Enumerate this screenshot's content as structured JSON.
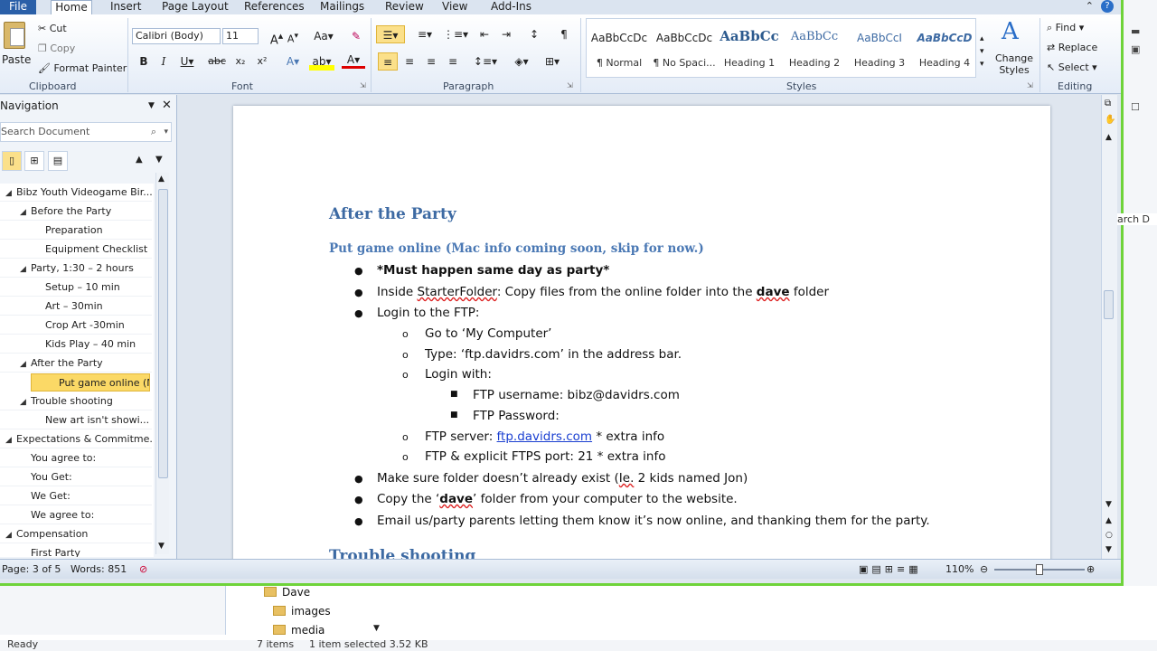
{
  "ribbon": {
    "tabs": [
      "File",
      "Home",
      "Insert",
      "Page Layout",
      "References",
      "Mailings",
      "Review",
      "View",
      "Add-Ins"
    ],
    "clipboard": {
      "paste": "Paste",
      "cut": "Cut",
      "copy": "Copy",
      "format_painter": "Format Painter",
      "label": "Clipboard"
    },
    "font": {
      "family": "Calibri (Body)",
      "size": "11",
      "label": "Font"
    },
    "paragraph": {
      "label": "Paragraph"
    },
    "styles": {
      "label": "Styles",
      "items": [
        {
          "sample": "AaBbCcDc",
          "name": "¶ Normal"
        },
        {
          "sample": "AaBbCcDc",
          "name": "¶ No Spaci..."
        },
        {
          "sample": "AaBbCc",
          "name": "Heading 1"
        },
        {
          "sample": "AaBbCc",
          "name": "Heading 2"
        },
        {
          "sample": "AaBbCcI",
          "name": "Heading 3"
        },
        {
          "sample": "AaBbCcD",
          "name": "Heading 4"
        }
      ],
      "change_styles": "Change Styles"
    },
    "editing": {
      "find": "Find",
      "replace": "Replace",
      "select": "Select",
      "label": "Editing"
    }
  },
  "nav": {
    "title": "Navigation",
    "search_placeholder": "Search Document",
    "items": [
      {
        "label": "Bibz Youth Videogame Bir...",
        "level": 0,
        "expand": true
      },
      {
        "label": "Before the Party",
        "level": 1,
        "expand": true
      },
      {
        "label": "Preparation",
        "level": 2,
        "expand": false
      },
      {
        "label": "Equipment Checklist",
        "level": 2,
        "expand": false
      },
      {
        "label": "Party, 1:30 – 2 hours",
        "level": 1,
        "expand": true
      },
      {
        "label": "Setup – 10 min",
        "level": 2,
        "expand": false
      },
      {
        "label": "Art – 30min",
        "level": 2,
        "expand": false
      },
      {
        "label": "Crop Art -30min",
        "level": 2,
        "expand": false
      },
      {
        "label": "Kids Play – 40 min",
        "level": 2,
        "expand": false
      },
      {
        "label": "After the Party",
        "level": 1,
        "expand": true
      },
      {
        "label": "Put game online (M...",
        "level": 2,
        "expand": false,
        "selected": true
      },
      {
        "label": "Trouble shooting",
        "level": 1,
        "expand": true
      },
      {
        "label": "New art isn't showi...",
        "level": 2,
        "expand": false
      },
      {
        "label": "Expectations & Commitme...",
        "level": 0,
        "expand": true
      },
      {
        "label": "You agree to:",
        "level": 1,
        "expand": false
      },
      {
        "label": "You Get:",
        "level": 1,
        "expand": false
      },
      {
        "label": "We Get:",
        "level": 1,
        "expand": false
      },
      {
        "label": "We agree to:",
        "level": 1,
        "expand": false
      },
      {
        "label": "Compensation",
        "level": 0,
        "expand": true
      },
      {
        "label": "First Party",
        "level": 1,
        "expand": false
      }
    ]
  },
  "doc": {
    "heading1": "After the Party",
    "heading2": "Put game online (Mac info coming soon, skip for now.)",
    "must": "*Must happen same day as party*",
    "inside_pre": "Inside ",
    "inside_folder": "StarterFolder",
    "inside_mid": ": Copy files from the online folder into the ",
    "inside_dave": "dave",
    "inside_post": " folder",
    "login_ftp": "Login to the FTP:",
    "goto": "Go to ‘My Computer’",
    "type": "Type: ‘ftp.davidrs.com’  in the address bar.",
    "login_with": "Login with:",
    "ftp_user": "FTP username: bibz@davidrs.com",
    "ftp_pass": "FTP Password:",
    "ftp_server_pre": "FTP server: ",
    "ftp_server_link": "ftp.davidrs.com",
    "ftp_server_post": "  * extra info",
    "ftp_port": "FTP & explicit FTPS port: 21 * extra info",
    "make_sure_pre": "Make sure folder doesn’t already exist (",
    "make_sure_ie": "Ie.",
    "make_sure_post": " 2 kids named Jon)",
    "copy_pre": "Copy the ‘",
    "copy_dave": "dave",
    "copy_post": "’ folder from your computer to the website.",
    "email": "Email us/party parents letting them know it’s now online, and thanking them for the party.",
    "next_heading": "Trouble shooting"
  },
  "status": {
    "page": "Page: 3 of 5",
    "words": "Words: 851",
    "zoom": "110%"
  },
  "explorer": {
    "folders": [
      "Dave",
      "images",
      "media"
    ],
    "ready": "Ready",
    "items": "7 items",
    "selected": "1 item selected  3.52 KB"
  },
  "side": {
    "search_cut": "arch D"
  }
}
